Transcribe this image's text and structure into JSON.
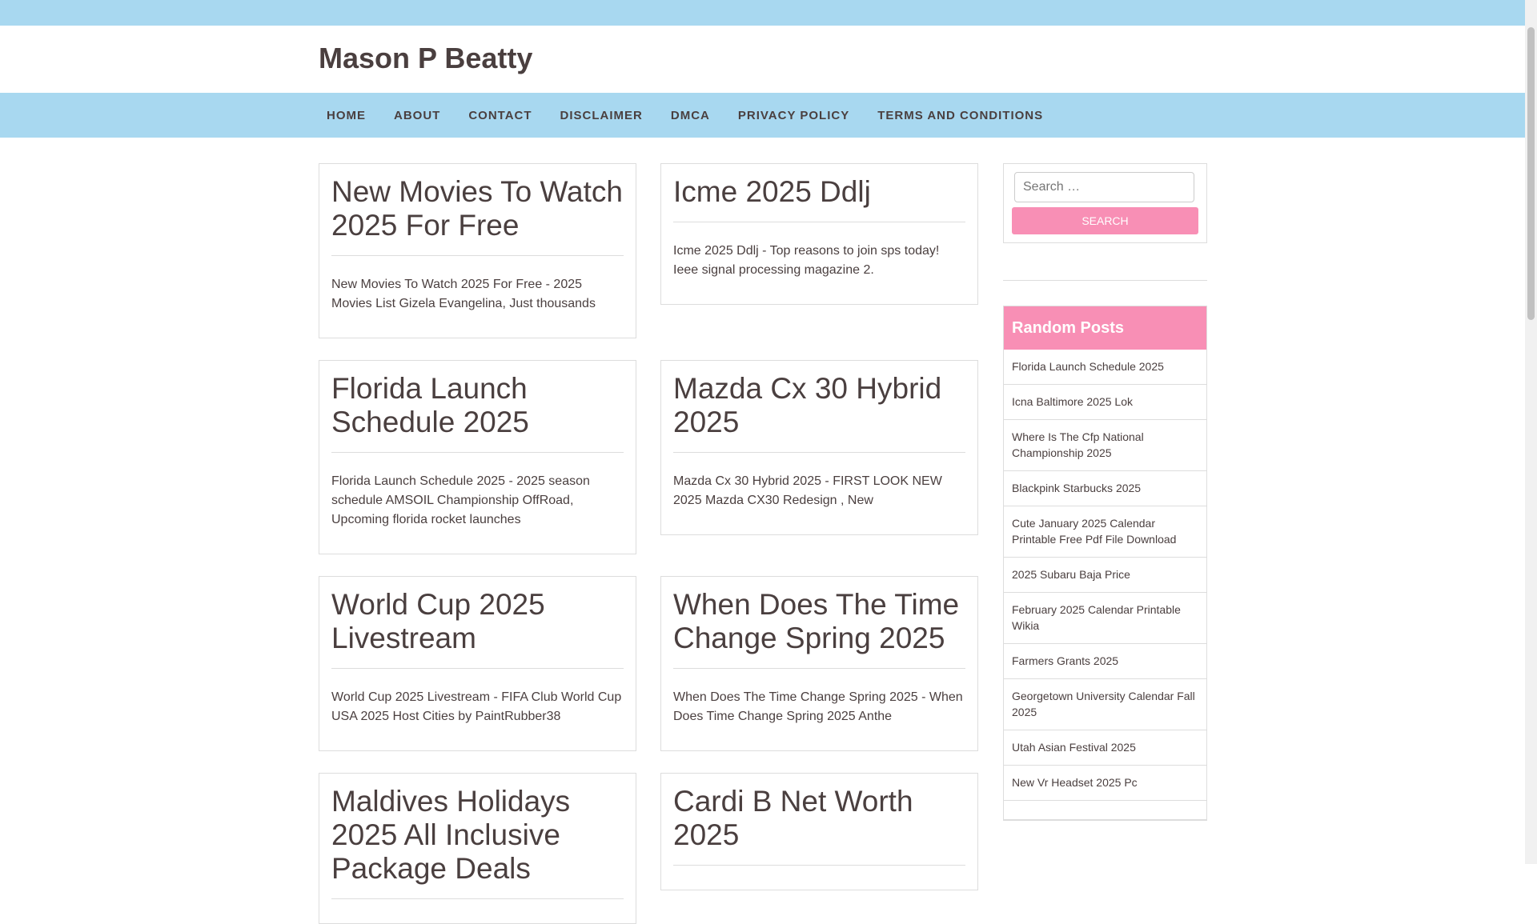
{
  "site": {
    "title": "Mason P Beatty"
  },
  "nav": {
    "items": [
      "HOME",
      "ABOUT",
      "CONTACT",
      "DISCLAIMER",
      "DMCA",
      "PRIVACY POLICY",
      "TERMS AND CONDITIONS"
    ]
  },
  "posts": [
    {
      "title": "New Movies To Watch 2025 For Free",
      "excerpt": "New Movies To Watch 2025 For Free - 2025 Movies List Gizela Evangelina, Just thousands"
    },
    {
      "title": "Icme 2025 Ddlj",
      "excerpt": "Icme 2025 Ddlj - Top reasons to join sps today! Ieee signal processing magazine 2."
    },
    {
      "title": "Florida Launch Schedule 2025",
      "excerpt": "Florida Launch Schedule 2025 - 2025 season schedule AMSOIL Championship OffRoad, Upcoming florida rocket launches"
    },
    {
      "title": "Mazda Cx 30 Hybrid 2025",
      "excerpt": "Mazda Cx 30 Hybrid 2025 - FIRST LOOK NEW 2025 Mazda CX30 Redesign , New"
    },
    {
      "title": "World Cup 2025 Livestream",
      "excerpt": "World Cup 2025 Livestream - FIFA Club World Cup USA 2025 Host Cities by PaintRubber38"
    },
    {
      "title": "When Does The Time Change Spring 2025",
      "excerpt": "When Does The Time Change Spring 2025 - When Does Time Change Spring 2025 Anthe"
    },
    {
      "title": "Maldives Holidays 2025 All Inclusive Package Deals",
      "excerpt": ""
    },
    {
      "title": "Cardi B Net Worth 2025",
      "excerpt": ""
    }
  ],
  "search": {
    "placeholder": "Search …",
    "button_label": "Search"
  },
  "random_posts": {
    "heading": "Random Posts",
    "items": [
      "Florida Launch Schedule 2025",
      "Icna Baltimore 2025 Lok",
      "Where Is The Cfp National Championship 2025",
      "Blackpink Starbucks 2025",
      "Cute January 2025 Calendar Printable Free Pdf File Download",
      "2025 Subaru Baja Price",
      "February 2025 Calendar Printable Wikia",
      "Farmers Grants 2025",
      "Georgetown University Calendar Fall 2025",
      "Utah Asian Festival 2025",
      "New Vr Headset 2025 Pc",
      ""
    ]
  },
  "colors": {
    "accent": "#a8d8f0",
    "pink": "#f88fb5",
    "text": "#4a3f3f"
  }
}
